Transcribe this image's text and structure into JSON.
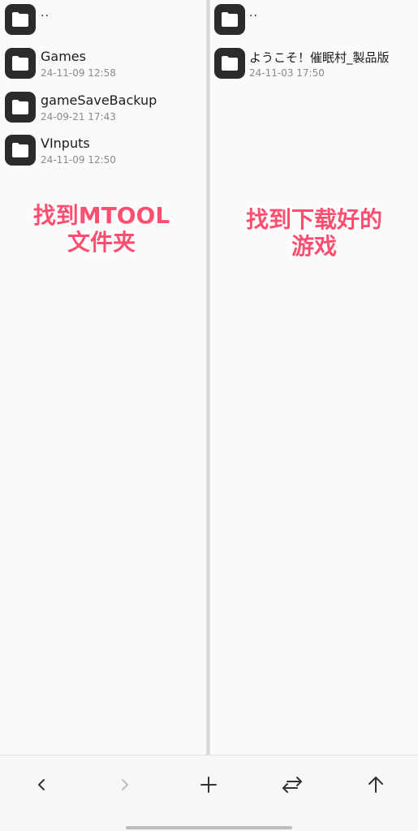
{
  "left_pane": {
    "items": [
      {
        "name": "..",
        "date": ""
      },
      {
        "name": "Games",
        "date": "24-11-09 12:58"
      },
      {
        "name": "gameSaveBackup",
        "date": "24-09-21 17:43"
      },
      {
        "name": "VInputs",
        "date": "24-11-09 12:50"
      }
    ],
    "annotation": {
      "line1": "找到MTOOL",
      "line2": "文件夹"
    }
  },
  "right_pane": {
    "items": [
      {
        "name": "..",
        "date": ""
      },
      {
        "name": "ようこそ！催眠村_製品版",
        "date": "24-11-03 17:50"
      }
    ],
    "annotation": {
      "line1": "找到下载好的",
      "line2": "游戏"
    }
  },
  "toolbar": {
    "buttons": [
      {
        "icon": "chevron-left-icon",
        "enabled": true
      },
      {
        "icon": "chevron-right-icon",
        "enabled": false
      },
      {
        "icon": "plus-icon",
        "enabled": true
      },
      {
        "icon": "swap-arrows-icon",
        "enabled": true
      },
      {
        "icon": "arrow-up-icon",
        "enabled": true
      }
    ]
  },
  "colors": {
    "folder_icon": "#2b2b2b",
    "annotation_text": "#ff4f70",
    "icon_active": "#333333",
    "icon_disabled": "#bdbdbd"
  }
}
